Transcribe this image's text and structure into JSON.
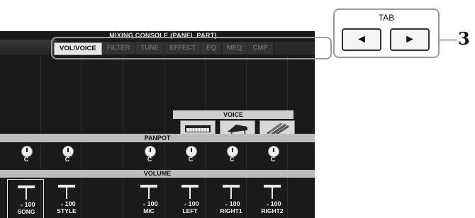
{
  "screen": {
    "title": "MIXING CONSOLE (PANEL PART)",
    "tabs": [
      {
        "label": "VOL/VOICE",
        "active": true
      },
      {
        "label": "FILTER",
        "active": false
      },
      {
        "label": "TUNE",
        "active": false
      },
      {
        "label": "EFFECT",
        "active": false
      },
      {
        "label": "EQ",
        "active": false
      },
      {
        "label": "MEQ",
        "active": false
      },
      {
        "label": "CMP",
        "active": false
      }
    ],
    "voice_label": "VOICE",
    "voice_icons": [
      "keyboard-icon",
      "piano-icon",
      "strings-icon"
    ],
    "panpot_label": "PANPOT",
    "volume_label": "VOLUME",
    "channels": [
      {
        "name": "SONG",
        "pan": "C",
        "volume": "100",
        "selected": true
      },
      {
        "name": "STYLE",
        "pan": "C",
        "volume": "100",
        "selected": false
      },
      {
        "name": "MIC",
        "pan": "C",
        "volume": "100",
        "selected": false
      },
      {
        "name": "LEFT",
        "pan": "C",
        "volume": "100",
        "selected": false
      },
      {
        "name": "RIGHT1",
        "pan": "C",
        "volume": "100",
        "selected": false
      },
      {
        "name": "RIGHT2",
        "pan": "C",
        "volume": "100",
        "selected": false
      }
    ]
  },
  "callout": {
    "title": "TAB",
    "left_button": "◄",
    "right_button": "►",
    "step_number": "3"
  }
}
